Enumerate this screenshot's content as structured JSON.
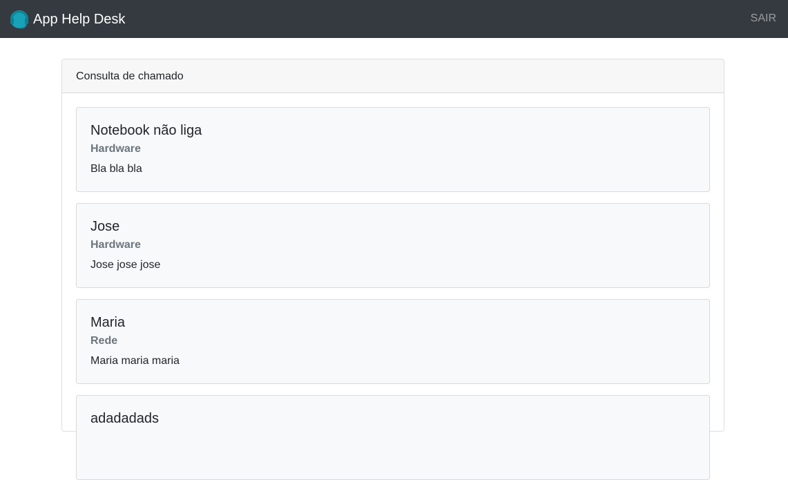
{
  "navbar": {
    "brand_text": "App Help Desk",
    "brand_icon": "headset-logo-icon",
    "logout_label": "SAIR",
    "background": "#343a40",
    "accent": "#17a2b8"
  },
  "card": {
    "header": "Consulta de chamado"
  },
  "tickets": [
    {
      "title": "Notebook não liga",
      "category": "Hardware",
      "description": "Bla bla bla"
    },
    {
      "title": "Jose",
      "category": "Hardware",
      "description": "Jose jose jose"
    },
    {
      "title": "Maria",
      "category": "Rede",
      "description": "Maria maria maria"
    },
    {
      "title": "adadadads",
      "category": "",
      "description": ""
    }
  ]
}
